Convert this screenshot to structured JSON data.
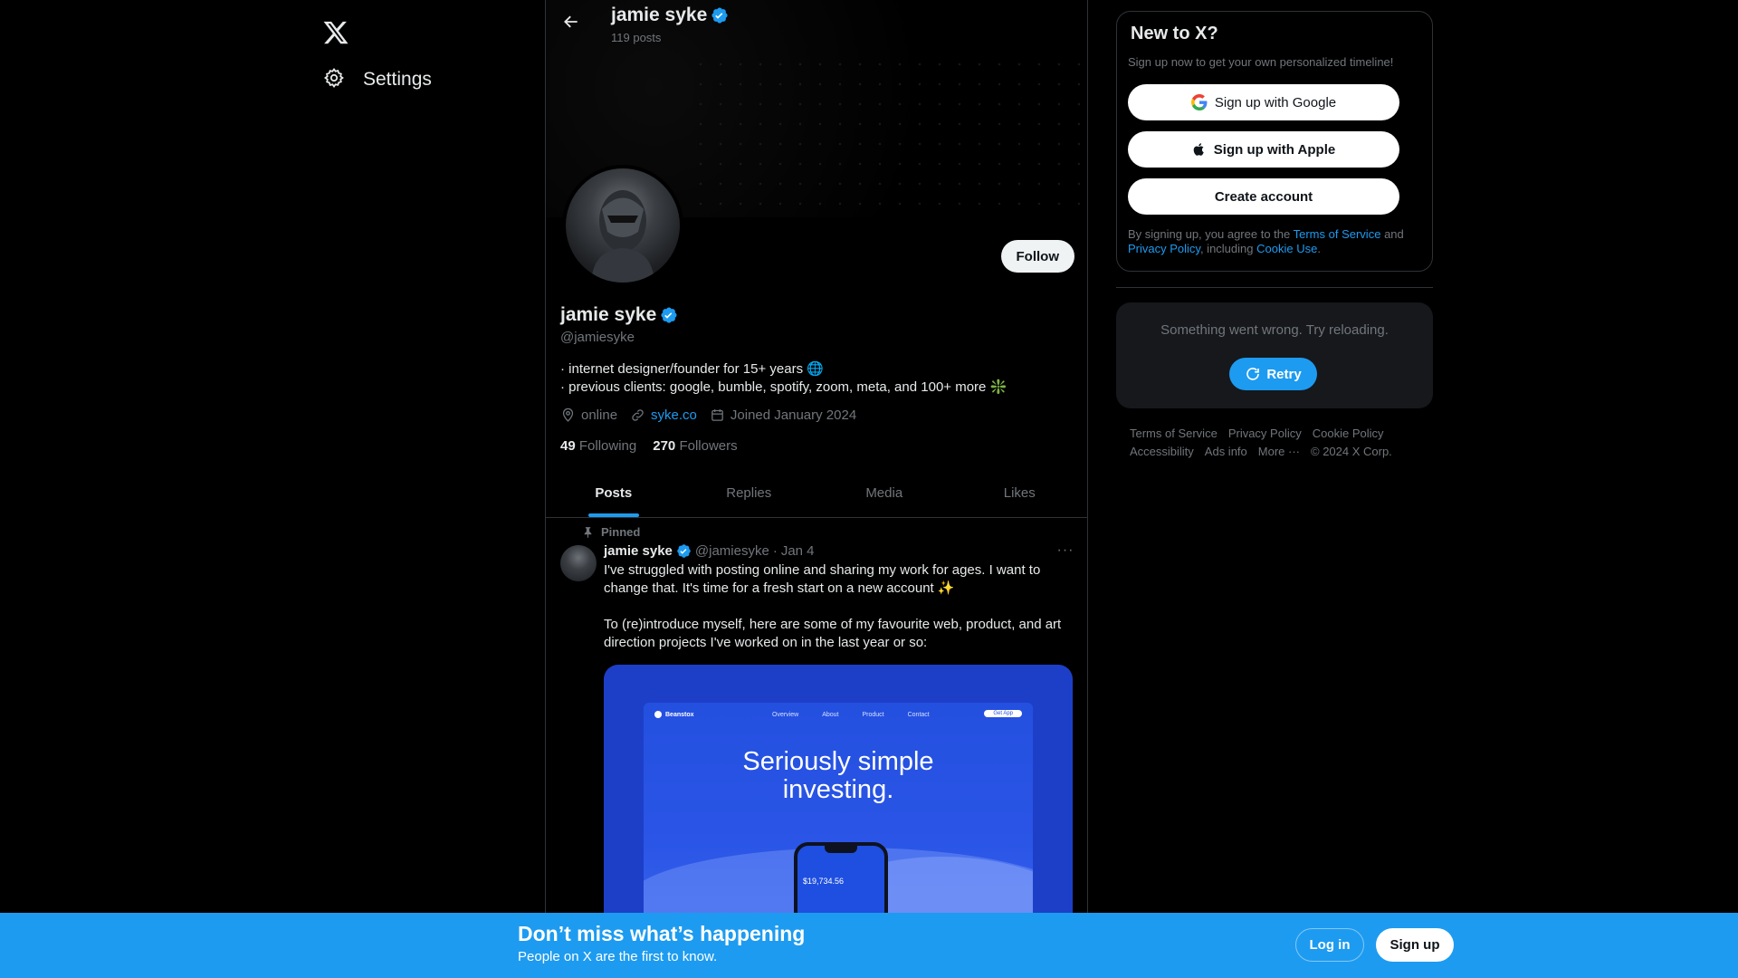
{
  "nav": {
    "logo_icon": "x-logo-icon",
    "settings_label": "Settings"
  },
  "topbar": {
    "title": "jamie syke",
    "posts_count": "119 posts"
  },
  "profile": {
    "name": "jamie syke",
    "handle": "@jamiesyke",
    "bio_line1": "· internet designer/founder for 15+ years 🌐",
    "bio_line2": "· previous clients: google, bumble, spotify, zoom, meta, and 100+ more ❇️",
    "location": "online",
    "website": "syke.co",
    "joined": "Joined January 2024",
    "following_count": "49",
    "following_label": "Following",
    "followers_count": "270",
    "followers_label": "Followers",
    "follow_button": "Follow"
  },
  "tabs": [
    {
      "label": "Posts",
      "active": true
    },
    {
      "label": "Replies",
      "active": false
    },
    {
      "label": "Media",
      "active": false
    },
    {
      "label": "Likes",
      "active": false
    }
  ],
  "tweet": {
    "pinned_label": "Pinned",
    "author_name": "jamie syke",
    "author_handle": "@jamiesyke",
    "separator": "·",
    "date": "Jan 4",
    "more": "···",
    "paragraph1": "I've struggled with posting online and sharing my work for ages. I want to change that. It's time for a fresh start on a new account ✨",
    "paragraph2": "To (re)introduce myself, here are some of my favourite web, product, and art direction projects I've worked on in the last year or so:",
    "media": {
      "brand": "Beanstox",
      "nav_links": [
        "Overview",
        "About",
        "Product",
        "Contact"
      ],
      "cta": "Get App",
      "headline_line1": "Seriously simple",
      "headline_line2": "investing.",
      "balance": "$19,734.56"
    }
  },
  "signup": {
    "title": "New to X?",
    "subtitle": "Sign up now to get your own personalized timeline!",
    "google_button": "Sign up with Google",
    "apple_button": "Sign up with Apple",
    "create_button": "Create account",
    "terms_prefix": "By signing up, you agree to the",
    "terms_link": "Terms of Service",
    "terms_and": "and",
    "privacy_link": "Privacy Policy",
    "terms_including": ", including",
    "cookie_link": "Cookie Use",
    "terms_end": "."
  },
  "error_card": {
    "message": "Something went wrong. Try reloading.",
    "retry_button": "Retry"
  },
  "footer": {
    "links": [
      "Terms of Service",
      "Privacy Policy",
      "Cookie Policy",
      "Accessibility",
      "Ads info",
      "More ···",
      "© 2024 X Corp."
    ]
  },
  "bottom_bar": {
    "title": "Don’t miss what’s happening",
    "subtitle": "People on X are the first to know.",
    "login_button": "Log in",
    "signup_button": "Sign up"
  },
  "colors": {
    "accent": "#1d9bf0",
    "background": "#000000",
    "text_primary": "#e7e9ea",
    "text_secondary": "#71767b"
  }
}
